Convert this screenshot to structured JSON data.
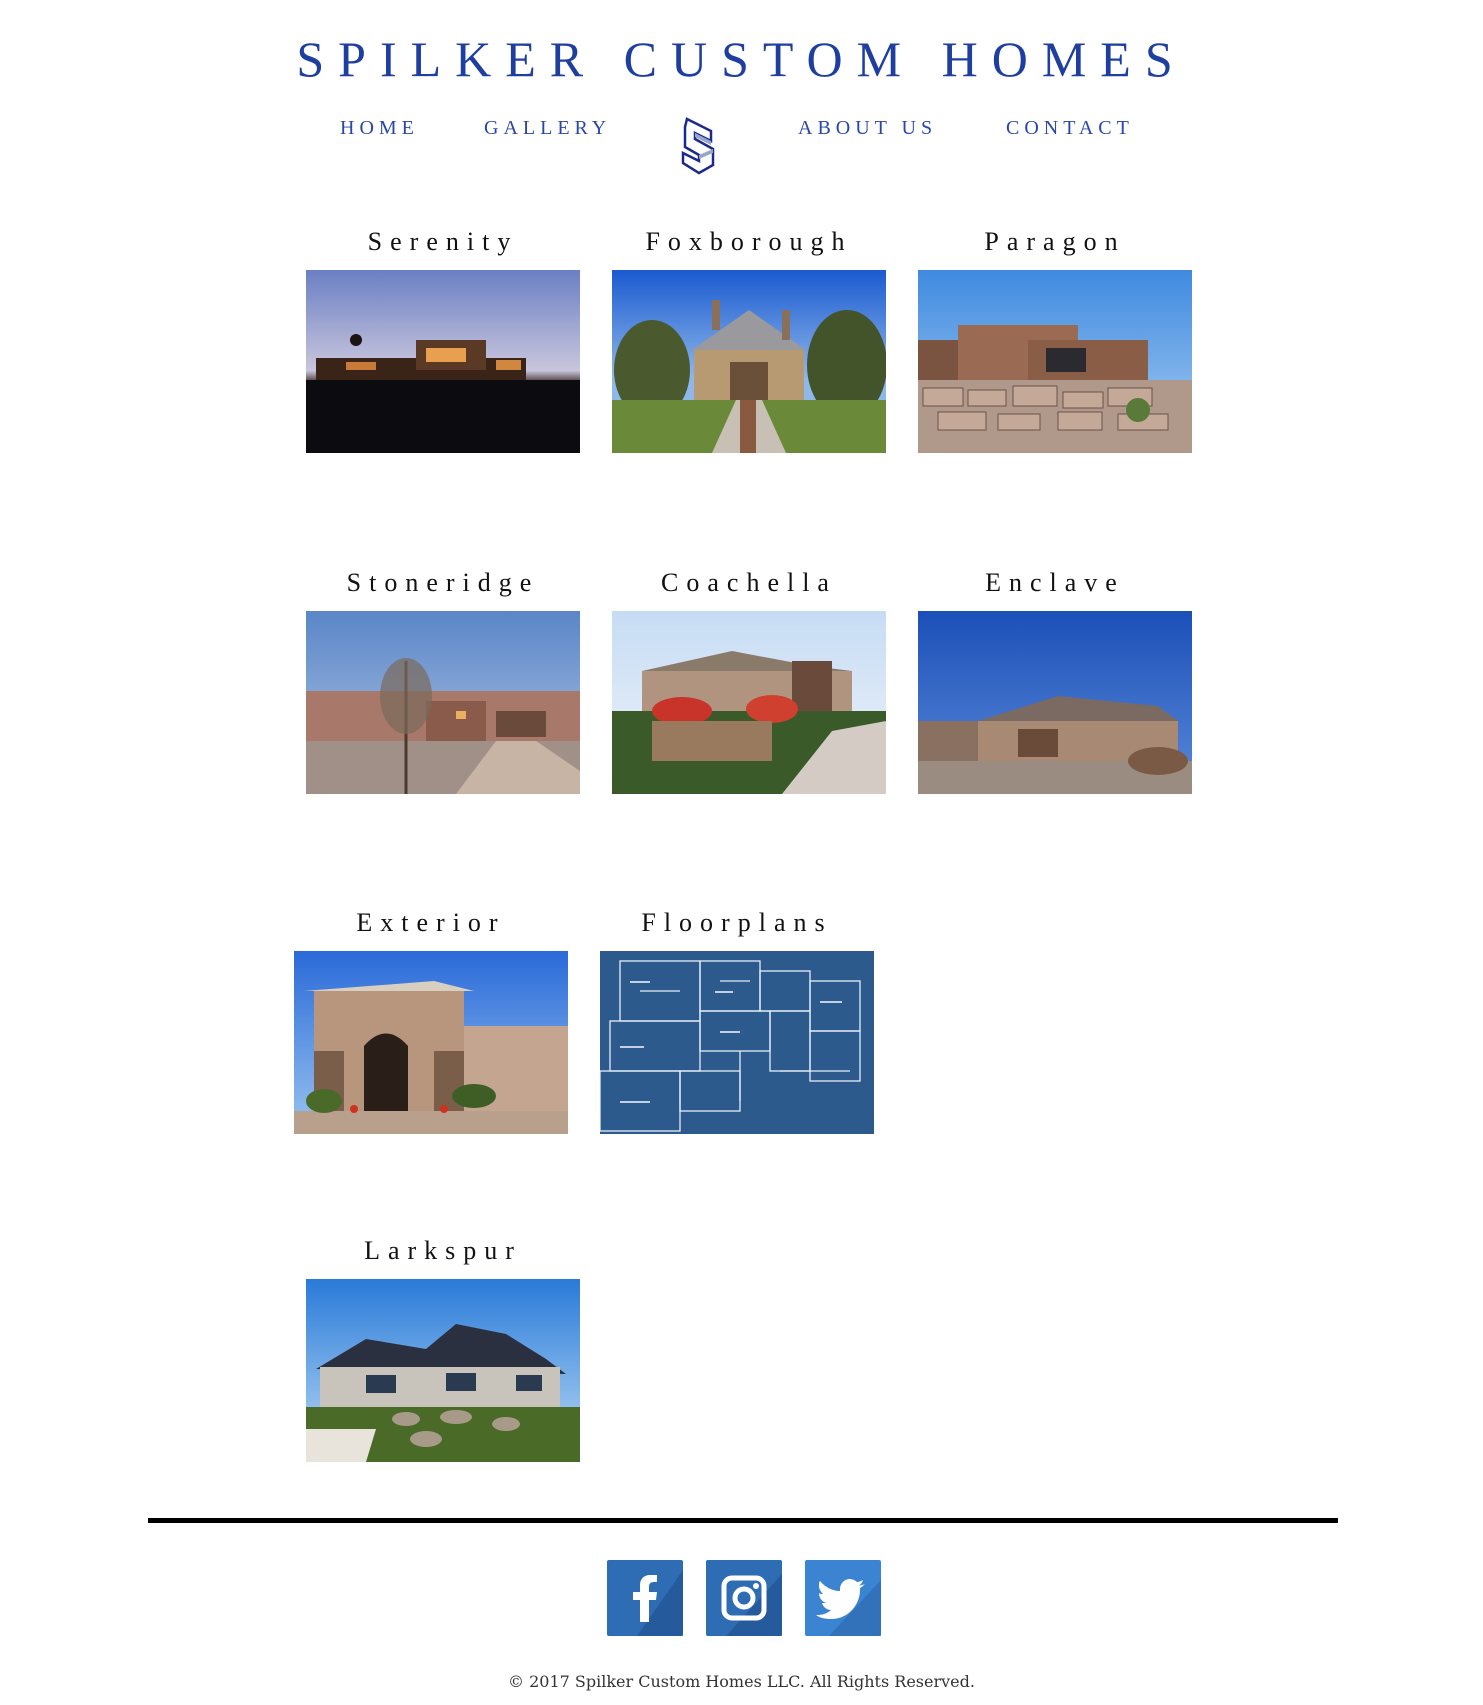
{
  "header": {
    "title": "SPILKER CUSTOM HOMES"
  },
  "nav": {
    "items": [
      {
        "label": "HOME"
      },
      {
        "label": "GALLERY"
      },
      {
        "label": "ABOUT US"
      },
      {
        "label": "CONTACT"
      }
    ]
  },
  "gallery": {
    "items": [
      {
        "label": "Serenity"
      },
      {
        "label": "Foxborough"
      },
      {
        "label": "Paragon"
      },
      {
        "label": "Stoneridge"
      },
      {
        "label": "Coachella"
      },
      {
        "label": "Enclave"
      },
      {
        "label": "Exterior"
      },
      {
        "label": "Floorplans"
      },
      {
        "label": "Larkspur"
      }
    ]
  },
  "social": {
    "items": [
      {
        "name": "facebook-icon",
        "color": "#2a6ab8"
      },
      {
        "name": "instagram-icon",
        "color": "#2a6ab8"
      },
      {
        "name": "twitter-icon",
        "color": "#3a82d0"
      }
    ]
  },
  "footer": {
    "copyright": "© 2017 Spilker Custom Homes LLC. All Rights Reserved."
  },
  "colors": {
    "brand_blue": "#1f3fa0",
    "divider": "#000000"
  }
}
